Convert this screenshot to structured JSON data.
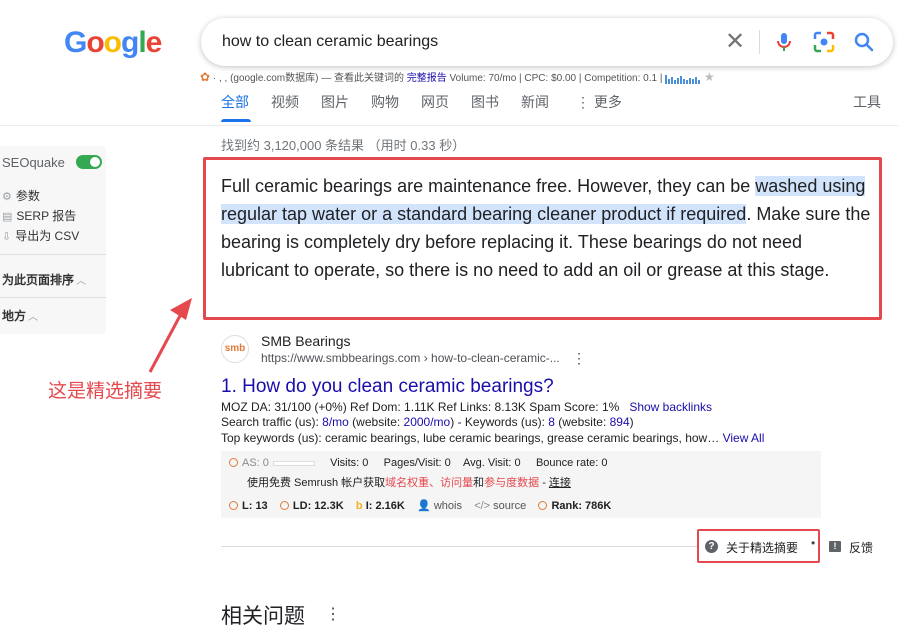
{
  "header": {
    "logo_letters": [
      {
        "ch": "G",
        "color": "#4285f4"
      },
      {
        "ch": "o",
        "color": "#ea4335"
      },
      {
        "ch": "o",
        "color": "#fbbc05"
      },
      {
        "ch": "g",
        "color": "#4285f4"
      },
      {
        "ch": "l",
        "color": "#34a853"
      },
      {
        "ch": "e",
        "color": "#ea4335"
      }
    ],
    "query": "how to clean ceramic bearings",
    "clear_glyph": "✕"
  },
  "seo_bar": {
    "prefix": "· , ,  (google.com数据库) — 查看此关键词的",
    "full_report": "完整报告",
    "metrics": "Volume: 70/mo | CPC: $0.00 | Competition: 0.1 |"
  },
  "tabs": [
    {
      "label": "全部",
      "active": true
    },
    {
      "label": "视频"
    },
    {
      "label": "图片"
    },
    {
      "label": "购物"
    },
    {
      "label": "网页"
    },
    {
      "label": "图书"
    },
    {
      "label": "新闻"
    },
    {
      "label": "⋮ 更多"
    }
  ],
  "tools_label": "工具",
  "result_stats": "找到约 3,120,000 条结果 （用时 0.33 秒）",
  "sidebar": {
    "title": "SEOquake",
    "items": [
      {
        "icon": "gear-icon",
        "glyph": "⚙",
        "label": "参数"
      },
      {
        "icon": "list-icon",
        "glyph": "▤",
        "label": "SERP 报告"
      },
      {
        "icon": "export-icon",
        "glyph": "⇩",
        "label": "导出为 CSV"
      }
    ],
    "section_1": "为此页面排序",
    "section_2": "地方"
  },
  "snippet": {
    "text_before": "Full ceramic bearings are maintenance free. However, they can be ",
    "text_highlight": "washed using regular tap water or a standard bearing cleaner product if required",
    "text_after": ". Make sure the bearing is completely dry before replacing it. These bearings do not need lubricant to operate, so there is no need to add an oil or grease at this stage."
  },
  "annotation_label": "这是精选摘要",
  "result": {
    "favicon_text": "smb",
    "site_name": "SMB Bearings",
    "url": "https://www.smbbearings.com › how-to-clean-ceramic-...",
    "number": "1.",
    "title": "How do you clean ceramic bearings?",
    "moz_line": "MOZ DA: 31/100 (+0%)   Ref Dom: 1.11K    Ref Links: 8.13K    Spam Score: 1%",
    "show_backlinks": "Show backlinks",
    "traffic_prefix": "Search traffic (us): ",
    "traffic_mo": "8/mo",
    "traffic_mid": " (website: ",
    "traffic_site": "2000/mo",
    "traffic_kw_prefix": ") - Keywords (us): ",
    "kw_count": "8",
    "kw_mid": " (website: ",
    "kw_site": "894",
    "kw_end": ")",
    "top_kw": "Top keywords (us): ceramic bearings, lube ceramic bearings, grease ceramic bearings, how…",
    "view_all": "View All"
  },
  "semrush": {
    "as": "AS: 0",
    "visits": "Visits: 0",
    "pages": "Pages/Visit: 0",
    "avg": "Avg. Visit: 0",
    "bounce": "Bounce rate: 0",
    "promo_prefix": "使用免费 Semrush 帐户获取",
    "promo_red": "域名权重、访问量",
    "promo_mid": "和",
    "promo_red2": "参与度数据",
    "promo_sep": " - ",
    "promo_link": "连接",
    "l": "L: 13",
    "ld": "LD: 12.3K",
    "i": "I: 2.16K",
    "whois": "whois",
    "source": "source",
    "rank": "Rank: 786K"
  },
  "about_snippet": "关于精选摘要",
  "feedback": "反馈",
  "related_heading": "相关问题",
  "colors": {
    "accent": "#1a73e8",
    "link": "#1a0dab",
    "annotation_red": "#e5484d",
    "highlight": "#d2e3fc"
  }
}
